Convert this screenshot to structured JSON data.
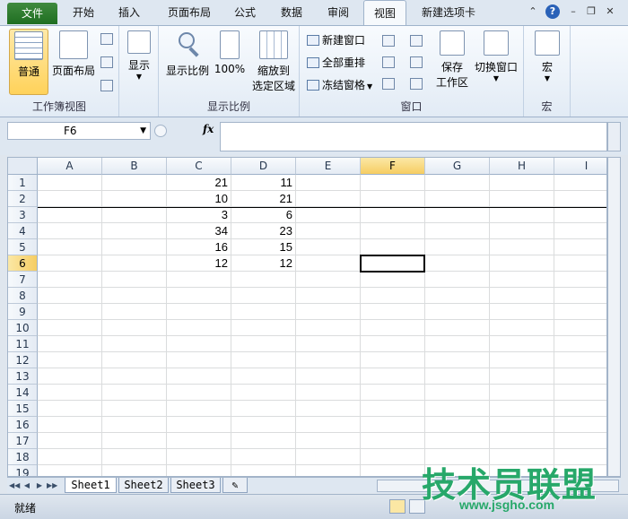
{
  "tabs": [
    {
      "label": "文件"
    },
    {
      "label": "开始"
    },
    {
      "label": "插入"
    },
    {
      "label": "页面布局"
    },
    {
      "label": "公式"
    },
    {
      "label": "数据"
    },
    {
      "label": "审阅"
    },
    {
      "label": "视图"
    },
    {
      "label": "新建选项卡"
    }
  ],
  "ribbon": {
    "workbook_views": {
      "normal": "普通",
      "page_layout": "页面布局",
      "group_label": "工作簿视图"
    },
    "show": {
      "label": "显示"
    },
    "zoom": {
      "zoom_label": "显示比例",
      "hundred_label": "100%",
      "zoom_selection_line1": "缩放到",
      "zoom_selection_line2": "选定区域",
      "group_label": "显示比例"
    },
    "window": {
      "new_window": "新建窗口",
      "arrange_all": "全部重排",
      "freeze_panes": "冻结窗格",
      "save_workspace_line1": "保存",
      "save_workspace_line2": "工作区",
      "switch_windows": "切换窗口",
      "group_label": "窗口"
    },
    "macros": {
      "label": "宏",
      "group_label": "宏"
    }
  },
  "formula_bar": {
    "name_box": "F6",
    "fx": "fx",
    "formula": ""
  },
  "grid": {
    "columns": [
      "A",
      "B",
      "C",
      "D",
      "E",
      "F",
      "G",
      "H",
      "I"
    ],
    "selected_column": "F",
    "rows": [
      "1",
      "2",
      "3",
      "4",
      "5",
      "6",
      "7",
      "8",
      "9",
      "10",
      "11",
      "12",
      "13",
      "14",
      "15",
      "16",
      "17",
      "18",
      "19"
    ],
    "selected_row": "6",
    "cells": {
      "C": [
        "21",
        "10",
        "3",
        "34",
        "16",
        "12"
      ],
      "D": [
        "11",
        "21",
        "6",
        "23",
        "15",
        "12"
      ]
    }
  },
  "sheets": [
    "Sheet1",
    "Sheet2",
    "Sheet3"
  ],
  "active_sheet": "Sheet1",
  "status": {
    "ready": "就绪"
  },
  "watermark": {
    "title": "技术员联盟",
    "url": "www.jsgho.com"
  },
  "colors": {
    "file_tab": "#2c7a2e",
    "selection_header": "#f6cd62",
    "watermark": "#27a86a"
  }
}
